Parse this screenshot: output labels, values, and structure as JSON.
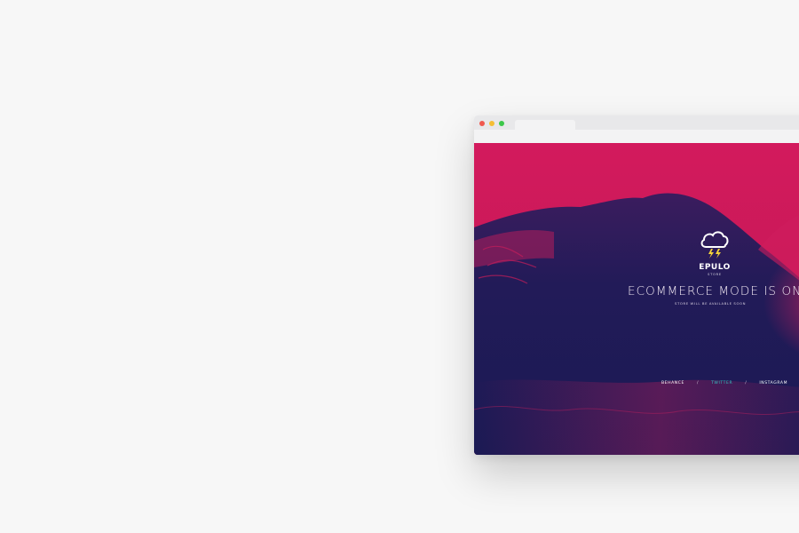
{
  "page": {
    "background": "#f7f7f7"
  },
  "browser": {
    "controls": {
      "close": "red",
      "minimize": "yellow",
      "maximize": "green"
    }
  },
  "site": {
    "brand": "EPULO",
    "brand_sub": "STORE",
    "headline": "ECOMMERCE MODE IS ON",
    "subline": "STORE WILL BE AVAILABLE SOON",
    "social": {
      "behance": "BEHANCE",
      "sep1": "/",
      "twitter": "TWITTER",
      "sep2": "/",
      "instagram": "INSTAGRAM"
    },
    "logo_icon": "storm-cloud-icon",
    "colors": {
      "top": "#d3185a",
      "wave": "#1c1a55",
      "accent": "#35c4c1",
      "bolt": "#f5d33a"
    }
  }
}
